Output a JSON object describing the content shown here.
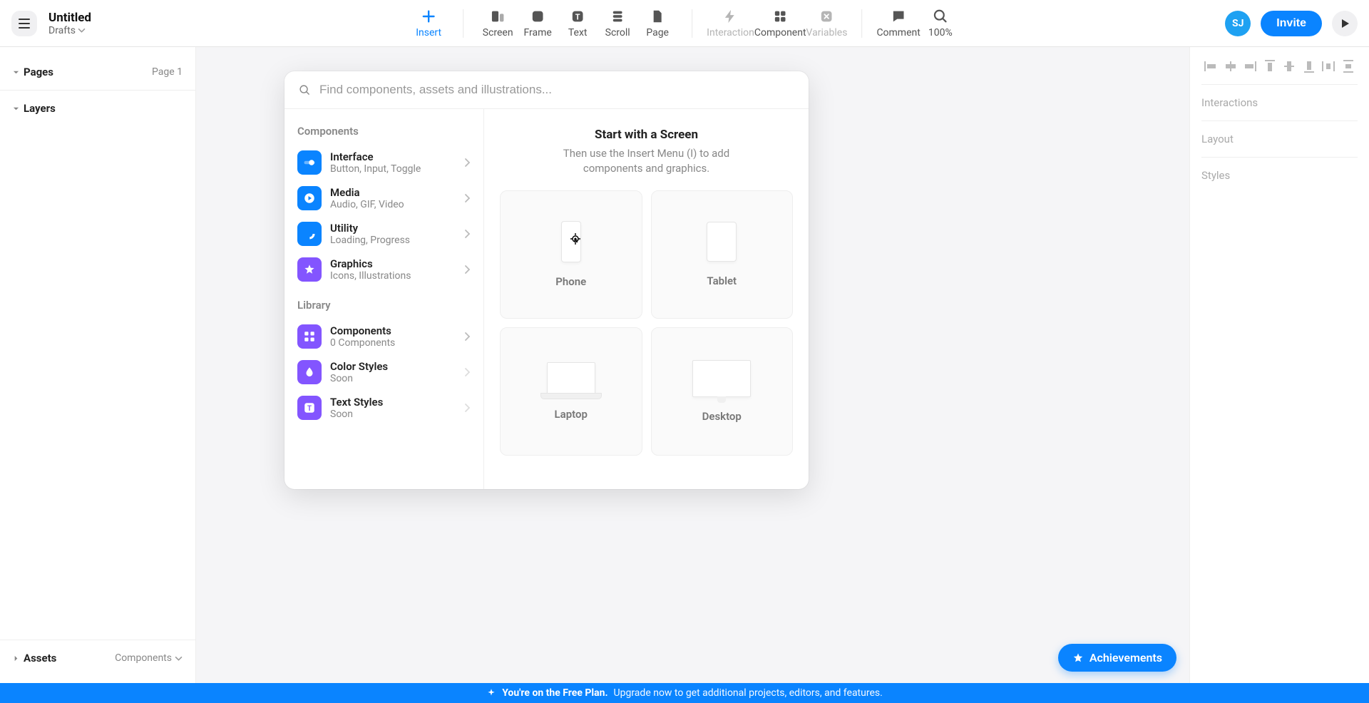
{
  "doc": {
    "title": "Untitled",
    "location": "Drafts"
  },
  "toolbar": {
    "insert": "Insert",
    "screen": "Screen",
    "frame": "Frame",
    "text": "Text",
    "scroll": "Scroll",
    "page": "Page",
    "interaction": "Interaction",
    "component": "Component",
    "variables": "Variables",
    "comment": "Comment",
    "zoom": "100%"
  },
  "user": {
    "initials": "SJ"
  },
  "buttons": {
    "invite": "Invite"
  },
  "leftSidebar": {
    "pagesLabel": "Pages",
    "pageIndicator": "Page 1",
    "layersLabel": "Layers",
    "assetsLabel": "Assets",
    "assetsMode": "Components"
  },
  "rightSidebar": {
    "interactions": "Interactions",
    "layout": "Layout",
    "styles": "Styles"
  },
  "insertPanel": {
    "searchPlaceholder": "Find components, assets and illustrations...",
    "componentsHeader": "Components",
    "libraryHeader": "Library",
    "componentsCategories": [
      {
        "title": "Interface",
        "sub": "Button, Input, Toggle",
        "color": "blue",
        "icon": "interface"
      },
      {
        "title": "Media",
        "sub": "Audio, GIF, Video",
        "color": "blue",
        "icon": "media"
      },
      {
        "title": "Utility",
        "sub": "Loading, Progress",
        "color": "blue",
        "icon": "utility"
      },
      {
        "title": "Graphics",
        "sub": "Icons, Illustrations",
        "color": "purple",
        "icon": "graphics"
      }
    ],
    "libraryCategories": [
      {
        "title": "Components",
        "sub": "0 Components",
        "color": "purple",
        "icon": "components",
        "dim": false
      },
      {
        "title": "Color Styles",
        "sub": "Soon",
        "color": "purple",
        "icon": "color",
        "dim": true
      },
      {
        "title": "Text Styles",
        "sub": "Soon",
        "color": "purple",
        "icon": "text",
        "dim": true
      }
    ],
    "starterTitle": "Start with a Screen",
    "starterSub": "Then use the Insert Menu (I) to add components and graphics.",
    "screens": [
      {
        "label": "Phone",
        "shape": "phone"
      },
      {
        "label": "Tablet",
        "shape": "tablet"
      },
      {
        "label": "Laptop",
        "shape": "laptop"
      },
      {
        "label": "Desktop",
        "shape": "desktop"
      }
    ]
  },
  "achievements": "Achievements",
  "footer": {
    "bold": "You're on the Free Plan.",
    "light": "Upgrade now to get additional projects, editors, and features."
  }
}
